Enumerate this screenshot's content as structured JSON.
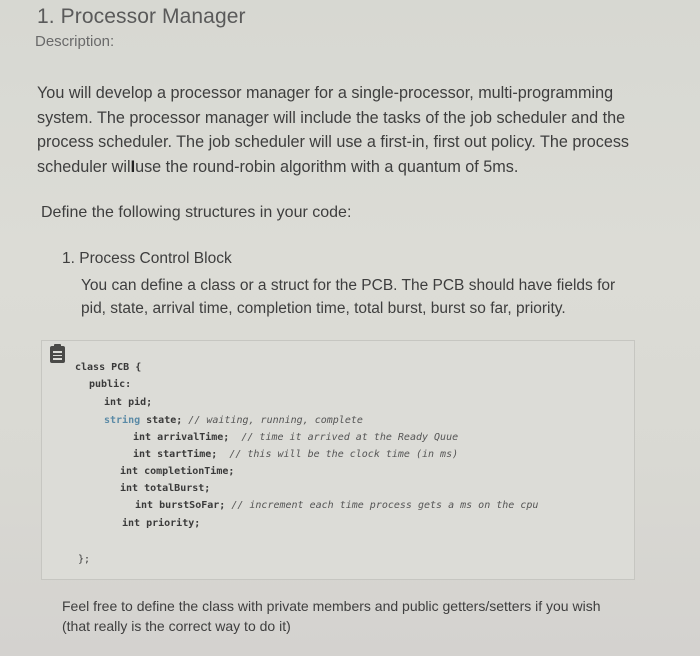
{
  "title": "1. Processor Manager",
  "description_label": "Description:",
  "paragraph": {
    "before_cursor": "You will develop a processor manager for a single-processor, multi-programming system. The processor manager will include the tasks of the job scheduler and the process scheduler. The job scheduler will use a first-in, first out policy. The process scheduler wil",
    "cursor_glyph": "I",
    "after_cursor": "use the round-robin algorithm with a quantum of 5ms."
  },
  "define_heading": "Define the following structures in your code:",
  "list": {
    "item_1_title": "1. Process Control Block",
    "item_1_desc": "You can define a class or a struct for the PCB. The PCB should have fields for pid, state, arrival time, completion time, total burst, burst so far, priority."
  },
  "code_block": {
    "icon": "clipboard-icon",
    "lines": {
      "l1": "class PCB {",
      "l2": "public:",
      "l3": "int pid;",
      "l4_type": "string",
      "l4_code": " state; ",
      "l4_comment": "// waiting, running, complete",
      "l5_code": "int arrivalTime;  ",
      "l5_comment": "// time it arrived at the Ready Quue",
      "l6_code": "int startTime;  ",
      "l6_comment": "// this will be the clock time (in ms)",
      "l7": "int completionTime;",
      "l8": "int totalBurst;",
      "l9_code": "int burstSoFar; ",
      "l9_comment": "// increment each time process gets a ms on the cpu",
      "l10": "int priority;",
      "l11": "};"
    }
  },
  "note": "Feel free to define the class with private members and public getters/setters if you wish (that really is the correct way to do it)"
}
